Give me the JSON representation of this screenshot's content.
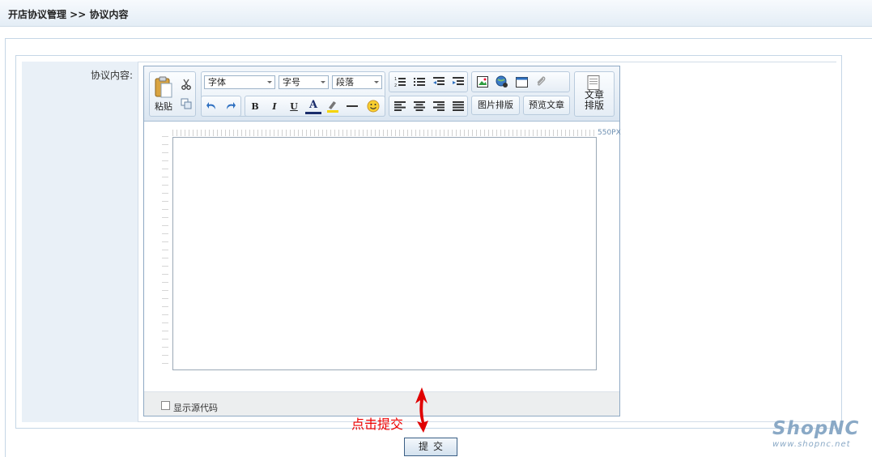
{
  "breadcrumb": "开店协议管理 >> 协议内容",
  "form": {
    "field_label": "协议内容:"
  },
  "toolbar": {
    "paste_label": "粘贴",
    "font_family_value": "字体",
    "font_size_value": "字号",
    "paragraph_value": "段落",
    "image_layout_label": "图片排版",
    "preview_label": "预览文章",
    "article_layout_line1": "文章",
    "article_layout_line2": "排版",
    "bold": "B",
    "italic": "I",
    "underline": "U",
    "font_color": "A"
  },
  "editor": {
    "ruler_width_label": "550PX",
    "show_source_label": "显示源代码"
  },
  "submit_label": "提交",
  "annotation": "点击提交",
  "logo": {
    "brand": "ShopNC",
    "url": "www.shopnc.net"
  },
  "colors": {
    "accent_red": "#e00000",
    "brand": "#8aa9c6",
    "border": "#8fa9c4"
  }
}
